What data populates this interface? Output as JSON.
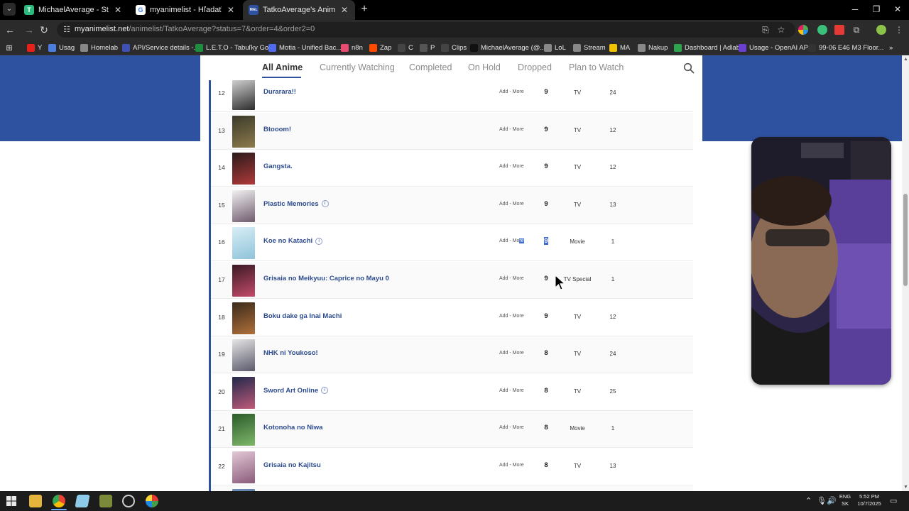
{
  "browser": {
    "tabs": [
      {
        "title": "MichaelAverage - Statistics - Tw",
        "favicon": "T",
        "favicon_color": "#2db87d",
        "active": false
      },
      {
        "title": "myanimelist - Hľadať Googlom",
        "favicon": "G",
        "favicon_color": "#ffffff",
        "active": false
      },
      {
        "title": "TatkoAverage's Anime List - My",
        "favicon": "MAL",
        "favicon_color": "#2e51a2",
        "active": true
      }
    ],
    "new_tab_label": "+",
    "url_domain": "myanimelist.net",
    "url_path": "/animelist/TatkoAverage?status=7&order=4&order2=0",
    "bookmarks": [
      {
        "label": "Y",
        "icon": "youtube-icon",
        "color": "#e62117"
      },
      {
        "label": "Usag",
        "icon": "globe-icon",
        "color": "#4a7fe0"
      },
      {
        "label": "Homelab",
        "icon": "folder-icon",
        "color": "#888888"
      },
      {
        "label": "API/Service details -...",
        "icon": "api-icon",
        "color": "#3f51b5"
      },
      {
        "label": "L.E.T.O - Tabuľky Go...",
        "icon": "sheets-icon",
        "color": "#1e8e3e"
      },
      {
        "label": "Motia - Unified Bac...",
        "icon": "motia-icon",
        "color": "#4f6cf0"
      },
      {
        "label": "n8n",
        "icon": "n8n-icon",
        "color": "#ea4b71"
      },
      {
        "label": "Zap",
        "icon": "zap-icon",
        "color": "#ff4a00"
      },
      {
        "label": "C",
        "icon": "c-icon",
        "color": "#444444"
      },
      {
        "label": "P",
        "icon": "p-icon",
        "color": "#555555"
      },
      {
        "label": "Clips",
        "icon": "clips-icon",
        "color": "#444444"
      },
      {
        "label": "MichaelAverage (@...",
        "icon": "tiktok-icon",
        "color": "#111111"
      },
      {
        "label": "LoL",
        "icon": "folder-icon",
        "color": "#888888"
      },
      {
        "label": "Stream",
        "icon": "folder-icon",
        "color": "#888888"
      },
      {
        "label": "MA",
        "icon": "ma-icon",
        "color": "#f2c200"
      },
      {
        "label": "Nakup",
        "icon": "folder-icon",
        "color": "#888888"
      },
      {
        "label": "Dashboard | Adlab",
        "icon": "adlab-icon",
        "color": "#2ea44f"
      },
      {
        "label": "Usage - OpenAI API",
        "icon": "openai-icon",
        "color": "#6b3fd1"
      },
      {
        "label": "99-06 E46 M3 Floor...",
        "icon": "ebay-icon",
        "color": "#333333"
      }
    ]
  },
  "status_tabs": [
    "All Anime",
    "Currently Watching",
    "Completed",
    "On Hold",
    "Dropped",
    "Plan to Watch"
  ],
  "rows": [
    {
      "num": "12",
      "title": "Durarara!!",
      "badge": false,
      "add": "Add - More",
      "score": "9",
      "type": "TV",
      "eps": "24",
      "thumb": [
        "#d9d9d9",
        "#2b2b2b"
      ]
    },
    {
      "num": "13",
      "title": "Btooom!",
      "badge": false,
      "add": "Add - More",
      "score": "9",
      "type": "TV",
      "eps": "12",
      "thumb": [
        "#3a3a2a",
        "#8d7a4c"
      ]
    },
    {
      "num": "14",
      "title": "Gangsta.",
      "badge": false,
      "add": "Add - More",
      "score": "9",
      "type": "TV",
      "eps": "12",
      "thumb": [
        "#2a1a1a",
        "#b03a3a"
      ]
    },
    {
      "num": "15",
      "title": "Plastic Memories",
      "badge": true,
      "add": "Add - More",
      "score": "9",
      "type": "TV",
      "eps": "13",
      "thumb": [
        "#f1f1f1",
        "#6f5a6e"
      ]
    },
    {
      "num": "16",
      "title": "Koe no Katachi",
      "badge": true,
      "add": "Add - More",
      "score": "9",
      "type": "Movie",
      "eps": "1",
      "thumb": [
        "#d8eef6",
        "#8fc3d9"
      ],
      "highlight": true
    },
    {
      "num": "17",
      "title": "Grisaia no Meikyuu: Caprice no Mayu 0",
      "badge": false,
      "add": "Add - More",
      "score": "9",
      "type": "TV Special",
      "eps": "1",
      "thumb": [
        "#3a1a24",
        "#c44a6a"
      ]
    },
    {
      "num": "18",
      "title": "Boku dake ga Inai Machi",
      "badge": false,
      "add": "Add - More",
      "score": "9",
      "type": "TV",
      "eps": "12",
      "thumb": [
        "#3a2a1c",
        "#b0703a"
      ]
    },
    {
      "num": "19",
      "title": "NHK ni Youkoso!",
      "badge": false,
      "add": "Add - More",
      "score": "8",
      "type": "TV",
      "eps": "24",
      "thumb": [
        "#e6e6e6",
        "#59596b"
      ]
    },
    {
      "num": "20",
      "title": "Sword Art Online",
      "badge": true,
      "add": "Add - More",
      "score": "8",
      "type": "TV",
      "eps": "25",
      "thumb": [
        "#20284a",
        "#c05a7a"
      ]
    },
    {
      "num": "21",
      "title": "Kotonoha no Niwa",
      "badge": false,
      "add": "Add - More",
      "score": "8",
      "type": "Movie",
      "eps": "1",
      "thumb": [
        "#2a5a2a",
        "#7fb86a"
      ]
    },
    {
      "num": "22",
      "title": "Grisaia no Kajitsu",
      "badge": false,
      "add": "Add - More",
      "score": "8",
      "type": "TV",
      "eps": "13",
      "thumb": [
        "#e3c9d6",
        "#8a5a7a"
      ]
    },
    {
      "num": "",
      "title": "",
      "badge": false,
      "add": "",
      "score": "",
      "type": "",
      "eps": "",
      "thumb": [
        "#6f8fb8",
        "#3a5a8a"
      ]
    }
  ],
  "taskbar": {
    "language": "ENG",
    "layout": "SK",
    "time": "5:52 PM",
    "date": "10/7/2025"
  }
}
